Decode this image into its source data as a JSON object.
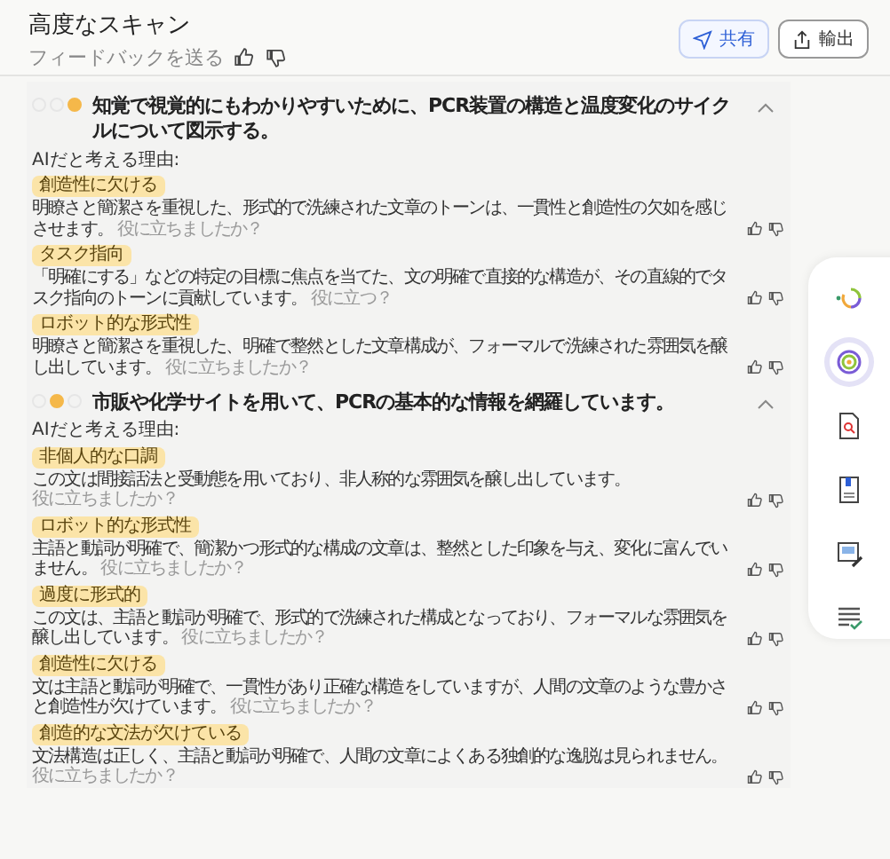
{
  "header": {
    "title": "高度なスキャン",
    "feedback_label": "フィードバックを送る",
    "share_button": "共有",
    "export_button": "輸出"
  },
  "sections": [
    {
      "dots": [
        {
          "on": false
        },
        {
          "on": false
        },
        {
          "on": true
        }
      ],
      "title": "知覚で視覚的にもわかりやすいために、PCR装置の構造と温度変化のサイクルについて図示する。",
      "expanded": true,
      "reasons_label": "AIだと考える理由:",
      "reasons": [
        {
          "tag": "創造性に欠ける",
          "text": "明瞭さと簡潔さを重視した、形式的で洗練された文章のトーンは、一貫性と創造性の欠如を感じさせます。",
          "helpful": "役に立ちましたか？"
        },
        {
          "tag": "タスク指向",
          "text": "「明確にする」などの特定の目標に焦点を当てた、文の明確で直接的な構造が、その直線的でタスク指向のトーンに貢献しています。",
          "helpful": "役に立つ？"
        },
        {
          "tag": "ロボット的な形式性",
          "text": "明瞭さと簡潔さを重視した、明確で整然とした文章構成が、フォーマルで洗練された雰囲気を醸し出しています。",
          "helpful": "役に立ちましたか？"
        }
      ]
    },
    {
      "dots": [
        {
          "on": false
        },
        {
          "on": true
        },
        {
          "on": false
        }
      ],
      "title": "市販や化学サイトを用いて、PCRの基本的な情報を網羅しています。",
      "expanded": true,
      "reasons_label": "AIだと考える理由:",
      "reasons": [
        {
          "tag": "非個人的な口調",
          "text": "この文は間接話法と受動態を用いており、非人称的な雰囲気を醸し出しています。",
          "helpful": "役に立ちましたか？"
        },
        {
          "tag": "ロボット的な形式性",
          "text": "主語と動詞が明確で、簡潔かつ形式的な構成の文章は、整然とした印象を与え、変化に富んでいません。",
          "helpful": "役に立ちましたか？"
        },
        {
          "tag": "過度に形式的",
          "text": "この文は、主語と動詞が明確で、形式的で洗練された構成となっており、フォーマルな雰囲気を醸し出しています。",
          "helpful": "役に立ちましたか？"
        },
        {
          "tag": "創造性に欠ける",
          "text": "文は主語と動詞が明確で、一貫性があり正確な構造をしていますが、人間の文章のような豊かさと創造性が欠けています。",
          "helpful": "役に立ちましたか？"
        },
        {
          "tag": "創造的な文法が欠けている",
          "text": "文法構造は正しく、主語と動詞が明確で、人間の文章によくある独創的な逸脱は見られません。",
          "helpful": "役に立ちましたか？"
        }
      ]
    }
  ],
  "side_tools": [
    {
      "kind": "ring"
    },
    {
      "kind": "scan",
      "selected": true
    },
    {
      "kind": "doc-search"
    },
    {
      "kind": "book"
    },
    {
      "kind": "edit"
    },
    {
      "kind": "list"
    }
  ]
}
